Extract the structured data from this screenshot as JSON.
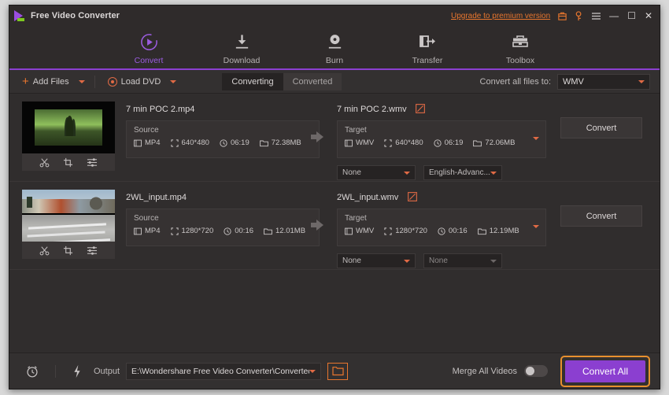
{
  "titlebar": {
    "app_title": "Free Video Converter",
    "upgrade_label": "Upgrade to premium version",
    "icons": [
      "cart-icon",
      "key-icon",
      "menu-icon"
    ],
    "minimize": "—",
    "maximize": "☐",
    "close": "✕"
  },
  "nav": {
    "items": [
      {
        "label": "Convert",
        "icon": "convert-icon",
        "active": true
      },
      {
        "label": "Download",
        "icon": "download-icon",
        "active": false
      },
      {
        "label": "Burn",
        "icon": "burn-icon",
        "active": false
      },
      {
        "label": "Transfer",
        "icon": "transfer-icon",
        "active": false
      },
      {
        "label": "Toolbox",
        "icon": "toolbox-icon",
        "active": false
      }
    ]
  },
  "toolbar": {
    "add_files_label": "Add Files",
    "load_dvd_label": "Load DVD",
    "tabs": [
      {
        "label": "Converting",
        "active": true
      },
      {
        "label": "Converted",
        "active": false
      }
    ],
    "convert_all_to_label": "Convert all files to:",
    "format_value": "WMV"
  },
  "rows": [
    {
      "thumb": "video-thumbnail-landscape",
      "source_name": "7 min POC 2.mp4",
      "source": {
        "title": "Source",
        "format": "MP4",
        "resolution": "640*480",
        "duration": "06:19",
        "size": "72.38MB"
      },
      "target_name": "7 min POC 2.wmv",
      "target": {
        "title": "Target",
        "format": "WMV",
        "resolution": "640*480",
        "duration": "06:19",
        "size": "72.06MB"
      },
      "subtitle_value": "None",
      "audio_value": "English-Advanc...",
      "convert_label": "Convert"
    },
    {
      "thumb": "video-thumbnail-street",
      "source_name": "2WL_input.mp4",
      "source": {
        "title": "Source",
        "format": "MP4",
        "resolution": "1280*720",
        "duration": "00:16",
        "size": "12.01MB"
      },
      "target_name": "2WL_input.wmv",
      "target": {
        "title": "Target",
        "format": "WMV",
        "resolution": "1280*720",
        "duration": "00:16",
        "size": "12.19MB"
      },
      "subtitle_value": "None",
      "audio_value": "None",
      "convert_label": "Convert"
    }
  ],
  "bottom": {
    "output_label": "Output",
    "output_path": "E:\\Wondershare Free Video Converter\\Converted",
    "merge_label": "Merge All Videos",
    "merge_on": false,
    "convert_all_label": "Convert All"
  },
  "colors": {
    "accent_purple": "#8b3fd0",
    "accent_orange": "#e8762e",
    "cta_border": "#e8902e",
    "window_bg": "#2b2828",
    "panel_bg": "#363232"
  }
}
